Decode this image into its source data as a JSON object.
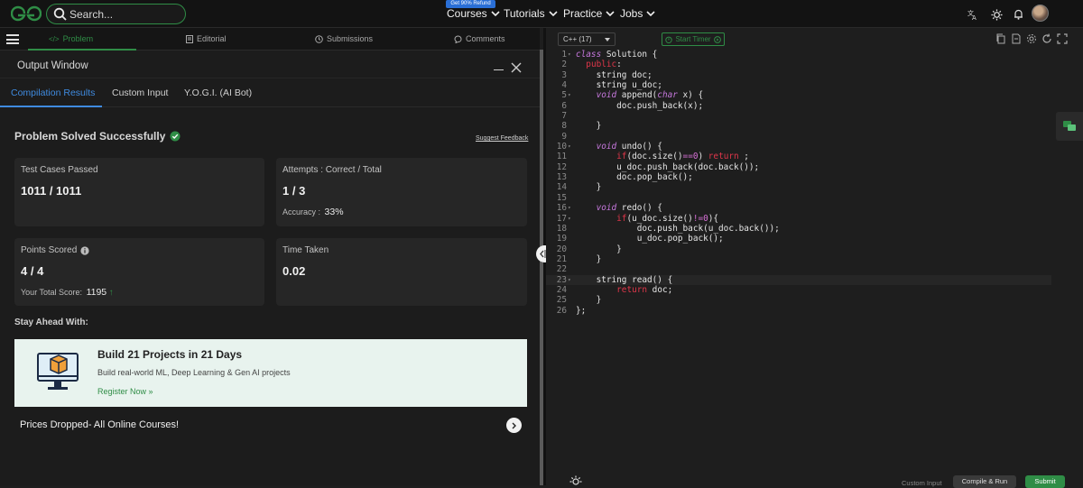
{
  "header": {
    "search_placeholder": "Search...",
    "refund_badge": "Get 90% Refund",
    "nav": [
      "Courses",
      "Tutorials",
      "Practice",
      "Jobs"
    ]
  },
  "tabs": [
    "Problem",
    "Editorial",
    "Submissions",
    "Comments"
  ],
  "output_window": {
    "title": "Output Window",
    "subtabs": [
      "Compilation Results",
      "Custom Input",
      "Y.O.G.I. (AI Bot)"
    ],
    "status": "Problem Solved Successfully",
    "feedback_link": "Suggest Feedback",
    "cards": {
      "test_cases": {
        "label": "Test Cases Passed",
        "value": "1011 / 1011"
      },
      "attempts": {
        "label": "Attempts : Correct / Total",
        "value": "1 / 3",
        "sub_label": "Accuracy :",
        "sub_value": "33%"
      },
      "points": {
        "label": "Points Scored",
        "value": "4 / 4",
        "sub_label": "Your Total Score:",
        "sub_value": "1195"
      },
      "time": {
        "label": "Time Taken",
        "value": "0.02"
      }
    },
    "stay_ahead": "Stay Ahead With:",
    "promo": {
      "title": "Build 21 Projects in 21 Days",
      "desc": "Build real-world ML, Deep Learning & Gen AI projects",
      "link": "Register Now »"
    },
    "prices": "Prices Dropped- All Online Courses!"
  },
  "editor": {
    "language": "C++ (17)",
    "timer": "Start Timer",
    "custom_input": "Custom Input",
    "compile_run": "Compile & Run",
    "submit": "Submit",
    "lines": [
      "1",
      "2",
      "3",
      "4",
      "5",
      "6",
      "7",
      "8",
      "9",
      "10",
      "11",
      "12",
      "13",
      "14",
      "15",
      "16",
      "17",
      "18",
      "19",
      "20",
      "21",
      "22",
      "23",
      "24",
      "25",
      "26"
    ]
  },
  "colors": {
    "accent_green": "#2f8d46",
    "accent_blue": "#3f8be0"
  }
}
